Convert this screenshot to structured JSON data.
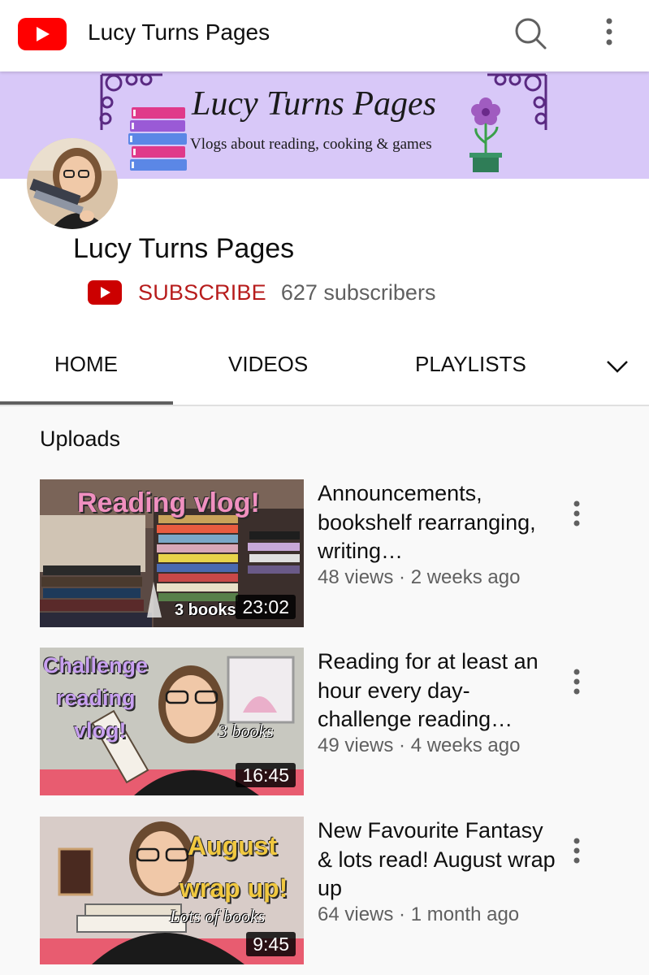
{
  "app": {
    "title": "Lucy Turns Pages",
    "logo_icon": "youtube-logo-icon",
    "search_icon": "search-icon",
    "more_icon": "more-vertical-icon",
    "brand_color": "#ff0000"
  },
  "banner": {
    "title": "Lucy Turns Pages",
    "subtitle": "Vlogs about reading, cooking & games",
    "background": "#d8c8f8"
  },
  "channel": {
    "name": "Lucy Turns Pages",
    "subscribe_label": "SUBSCRIBE",
    "subscribers": "627 subscribers",
    "subscribe_color": "#b71c1c"
  },
  "tabs": [
    {
      "label": "HOME",
      "active": true
    },
    {
      "label": "VIDEOS",
      "active": false
    },
    {
      "label": "PLAYLISTS",
      "active": false
    }
  ],
  "tabs_more_icon": "chevron-down-icon",
  "section": {
    "title": "Uploads"
  },
  "videos": [
    {
      "title": "Announcements, bookshelf rearranging, writing…",
      "meta": "48 views · 2 weeks ago",
      "duration": "23:02",
      "thumb_text": [
        "Reading vlog!",
        "3 books"
      ]
    },
    {
      "title": "Reading for at least an hour every day- challenge reading…",
      "meta": "49 views · 4 weeks ago",
      "duration": "16:45",
      "thumb_text": [
        "Challenge",
        "reading",
        "vlog!",
        "3 books"
      ]
    },
    {
      "title": "New Favourite Fantasy & lots read! August wrap up",
      "meta": "64 views · 1 month ago",
      "duration": "9:45",
      "thumb_text": [
        "August",
        "wrap up!",
        "Lots of books"
      ]
    }
  ]
}
